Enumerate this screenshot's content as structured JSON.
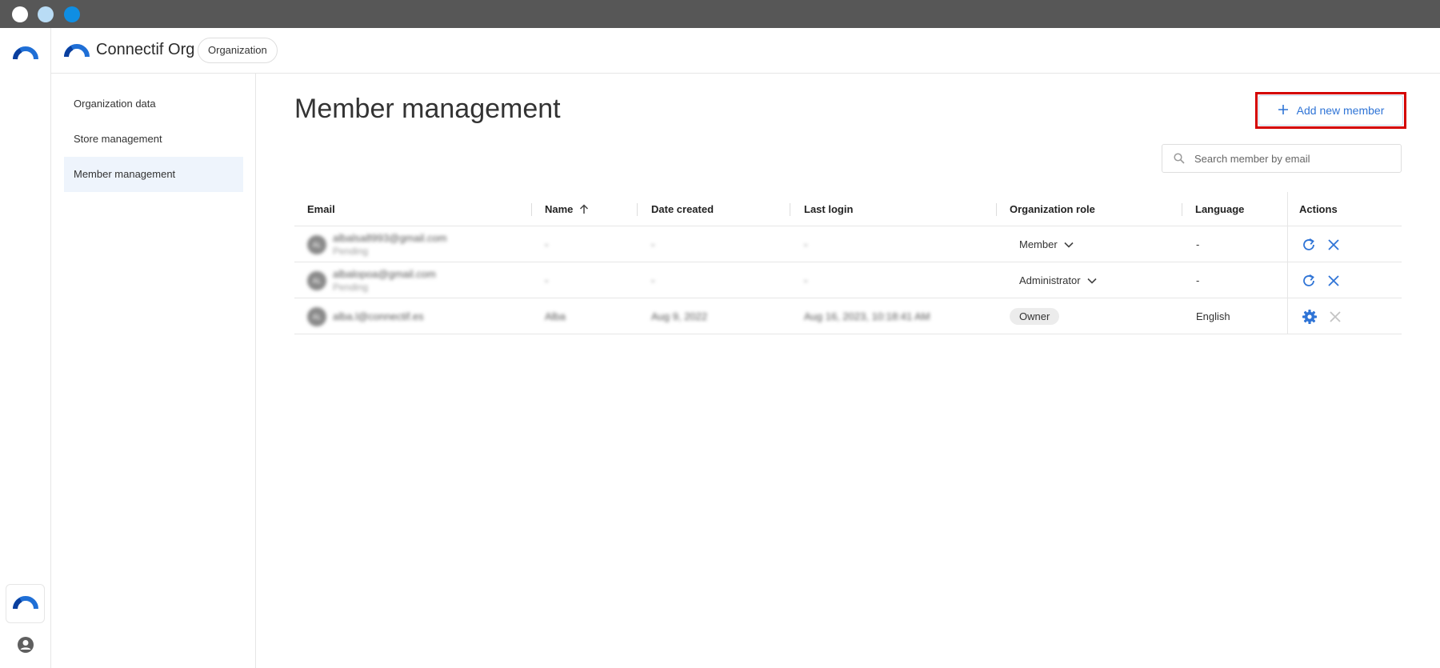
{
  "window": {
    "controls": [
      "close",
      "minimize",
      "maximize"
    ]
  },
  "header": {
    "org_name": "Connectif Org",
    "org_badge": "Organization"
  },
  "subnav": {
    "items": [
      {
        "label": "Organization data",
        "active": false
      },
      {
        "label": "Store management",
        "active": false
      },
      {
        "label": "Member management",
        "active": true
      }
    ]
  },
  "main": {
    "title": "Member management",
    "add_button_label": "Add new member",
    "search_placeholder": "Search member by email"
  },
  "table": {
    "columns": [
      "Email",
      "Name",
      "Date created",
      "Last login",
      "Organization role",
      "Language",
      "Actions"
    ],
    "sort": {
      "column": "Name",
      "direction": "asc"
    },
    "rows": [
      {
        "initials": "AL",
        "email": "albalsa8993@gmail.com",
        "status": "Pending",
        "name": "-",
        "date_created": "-",
        "last_login": "-",
        "role": "Member",
        "role_type": "dropdown",
        "language": "-",
        "actions": [
          "refresh",
          "remove"
        ]
      },
      {
        "initials": "AL",
        "email": "albalopoa@gmail.com",
        "status": "Pending",
        "name": "-",
        "date_created": "-",
        "last_login": "-",
        "role": "Administrator",
        "role_type": "dropdown",
        "language": "-",
        "actions": [
          "refresh",
          "remove"
        ]
      },
      {
        "initials": "AL",
        "email": "alba.l@connectif.es",
        "status": "",
        "name": "Alba",
        "date_created": "Aug 9, 2022",
        "last_login": "Aug 16, 2023, 10:18:41 AM",
        "role": "Owner",
        "role_type": "chip",
        "language": "English",
        "actions": [
          "settings",
          "remove-disabled"
        ]
      }
    ]
  },
  "colors": {
    "accent": "#2f74d6",
    "highlight_border": "#d40000",
    "active_nav_bg": "#eef4fc",
    "logo_blue": "#1f6fd6"
  }
}
